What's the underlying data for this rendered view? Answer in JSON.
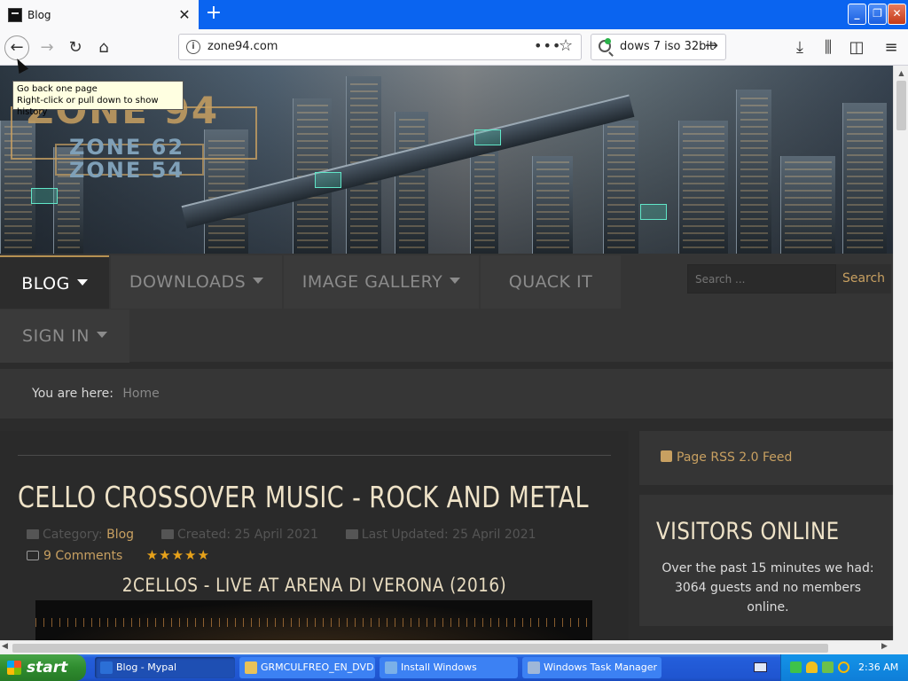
{
  "browser": {
    "tab_title": "Blog",
    "url": "zone94.com",
    "search_text": "dows 7 iso 32bit",
    "tooltip_line1": "Go back one page",
    "tooltip_line2": "Right-click or pull down to show history",
    "icons": [
      "back-arrow-icon",
      "forward-arrow-icon",
      "reload-icon",
      "home-icon",
      "info-icon",
      "more-actions-icon",
      "bookmark-star-icon",
      "search-engine-icon",
      "go-arrow-icon",
      "download-icon",
      "library-icon",
      "sidebar-icon",
      "hamburger-menu-icon"
    ]
  },
  "site": {
    "logo_main": "ZONE 94",
    "logo_sub1": "ZONE 62",
    "logo_sub2": "ZONE 54",
    "menu": {
      "blog": "BLOG",
      "downloads": "DOWNLOADS",
      "gallery": "IMAGE GALLERY",
      "quack": "QUACK IT",
      "signin": "SIGN IN"
    },
    "search_placeholder": "Search ...",
    "search_button": "Search",
    "breadcrumb_label": "You are here:",
    "breadcrumb_home": "Home"
  },
  "article": {
    "title": "CELLO CROSSOVER MUSIC - ROCK AND METAL",
    "category_label": "Category:",
    "category_link": "Blog",
    "created": "Created: 25 April 2021",
    "updated": "Last Updated: 25 April 2021",
    "comments": "9 Comments",
    "rating_stars": "★★★★★",
    "rating": 5,
    "subtitle": "2CELLOS - LIVE AT ARENA DI VERONA (2016)"
  },
  "sidebar": {
    "rss": "Page RSS 2.0 Feed",
    "visitors_title": "VISITORS ONLINE",
    "visitors_text": "Over the past 15 minutes we had: 3064 guests and no members online."
  },
  "taskbar": {
    "start": "start",
    "tasks": [
      {
        "label": "Blog - Mypal",
        "icon_color": "#2b6fd6"
      },
      {
        "label": "GRMCULFREO_EN_DVD",
        "icon_color": "#e8c25a"
      },
      {
        "label": "Install Windows",
        "icon_color": "#7ab0e8"
      },
      {
        "label": "Windows Task Manager",
        "icon_color": "#9fb7d8"
      }
    ],
    "clock": "2:36 AM"
  },
  "colors": {
    "accent_gold": "#c8a061",
    "xp_blue": "#245edb",
    "tray_blue": "#0f7ed8",
    "star_orange": "#e7a21a"
  }
}
